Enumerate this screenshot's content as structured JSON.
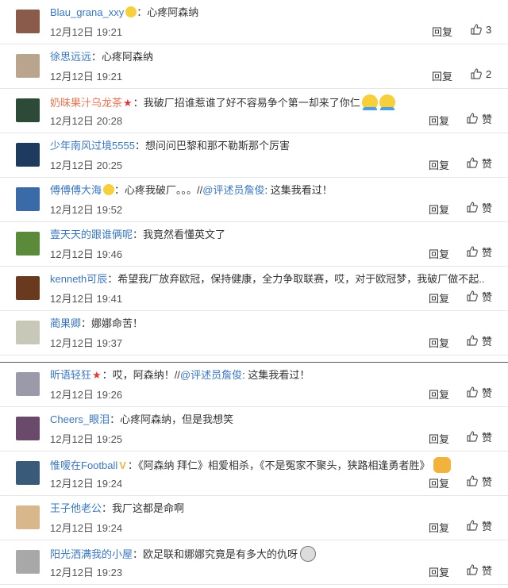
{
  "labels": {
    "reply": "回复",
    "like": "赞"
  },
  "comments_top": [
    {
      "user": "Blau_grana_xxy",
      "user_style": "blue",
      "badge": "emoji",
      "text": "心疼阿森纳",
      "time": "12月12日 19:21",
      "likes": "3",
      "avatar": "#8a5a4a"
    },
    {
      "user": "徐思远远",
      "user_style": "blue",
      "badge": "",
      "text": "心疼阿森纳",
      "time": "12月12日 19:21",
      "likes": "2",
      "avatar": "#b9a48e"
    },
    {
      "user": "奶昧果汁乌龙茶",
      "user_style": "red",
      "badge": "star",
      "text": "我破厂招谁惹谁了好不容易争个第一却来了你仁",
      "time": "12月12日 20:28",
      "likes": "赞",
      "avatar": "#2d4a38",
      "tail_emoji": true
    },
    {
      "user": "少年南风过境5555",
      "user_style": "blue",
      "badge": "",
      "text": "想问问巴黎和那不勒斯那个厉害",
      "time": "12月12日 20:25",
      "likes": "赞",
      "avatar": "#1e3a5e"
    },
    {
      "user": "傅傅傅大海",
      "user_style": "blue",
      "badge": "emoji",
      "text": "心疼我破厂。。。//",
      "mention": "@评述员詹俊",
      "text2": ": 这集我看过！",
      "time": "12月12日 19:52",
      "likes": "赞",
      "avatar": "#3a6aa8"
    },
    {
      "user": "壹天天的跟谁俩呢",
      "user_style": "blue",
      "badge": "",
      "text": "我竟然看懂英文了",
      "time": "12月12日 19:46",
      "likes": "赞",
      "avatar": "#5a8a3a"
    },
    {
      "user": "kenneth可辰",
      "user_style": "blue",
      "badge": "",
      "text": "希望我厂放弃欧冠，保持健康，全力争取联赛，哎，对于欧冠梦，我破厂做不起..",
      "time": "12月12日 19:41",
      "likes": "赞",
      "avatar": "#6a3a1e"
    },
    {
      "user": "蔺果卿",
      "user_style": "blue",
      "badge": "",
      "text": "娜娜命苦！",
      "time": "12月12日 19:37",
      "likes": "赞",
      "avatar": "#c8c8b8"
    }
  ],
  "comments_bottom": [
    {
      "user": "昕语轻狂",
      "user_style": "blue",
      "badge": "star",
      "text": "哎，阿森纳！//",
      "mention": "@评述员詹俊",
      "text2": ": 这集我看过！",
      "time": "12月12日 19:26",
      "likes": "赞",
      "avatar": "#9a9aa8"
    },
    {
      "user": "Cheers_眼泪",
      "user_style": "blue",
      "badge": "",
      "text": "心疼阿森纳，但是我想笑",
      "time": "12月12日 19:25",
      "likes": "赞",
      "avatar": "#6a4a6a"
    },
    {
      "user": "惟嗳在Football",
      "user_style": "blue",
      "badge": "v",
      "text": "《阿森纳 拜仁》相爱相杀，《不是冤家不聚头，狭路相逢勇者胜》",
      "time": "12月12日 19:24",
      "likes": "赞",
      "avatar": "#3a5a7a",
      "tail_fist": true
    },
    {
      "user": "王子他老公",
      "user_style": "blue",
      "badge": "",
      "text": "我厂这都是命啊",
      "time": "12月12日 19:24",
      "likes": "赞",
      "avatar": "#d8b88a"
    },
    {
      "user": "阳光洒满我的小屋",
      "user_style": "blue",
      "badge": "",
      "text": "欧足联和娜娜究竟是有多大的仇呀",
      "time": "12月12日 19:23",
      "likes": "赞",
      "avatar": "#a8a8a8",
      "tail_ghost": true
    }
  ]
}
